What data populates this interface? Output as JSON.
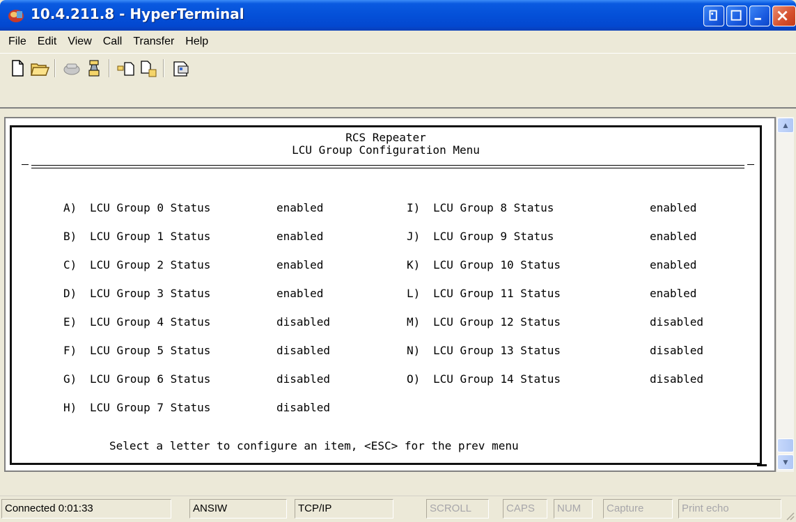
{
  "window": {
    "title": "10.4.211.8 - HyperTerminal"
  },
  "menu": [
    "File",
    "Edit",
    "View",
    "Call",
    "Transfer",
    "Help"
  ],
  "toolbar": {
    "icons": [
      "new-icon",
      "open-icon",
      "disconnect-icon",
      "connect-icon",
      "send-icon",
      "receive-icon",
      "properties-icon"
    ]
  },
  "terminal": {
    "title_line1": "RCS Repeater",
    "title_line2": "LCU Group Configuration Menu",
    "left_items": [
      {
        "key": "A)",
        "label": "LCU Group 0 Status",
        "status": "enabled"
      },
      {
        "key": "B)",
        "label": "LCU Group 1 Status",
        "status": "enabled"
      },
      {
        "key": "C)",
        "label": "LCU Group 2 Status",
        "status": "enabled"
      },
      {
        "key": "D)",
        "label": "LCU Group 3 Status",
        "status": "enabled"
      },
      {
        "key": "E)",
        "label": "LCU Group 4 Status",
        "status": "disabled"
      },
      {
        "key": "F)",
        "label": "LCU Group 5 Status",
        "status": "disabled"
      },
      {
        "key": "G)",
        "label": "LCU Group 6 Status",
        "status": "disabled"
      },
      {
        "key": "H)",
        "label": "LCU Group 7 Status",
        "status": "disabled"
      }
    ],
    "right_items": [
      {
        "key": "I)",
        "label": "LCU Group 8 Status",
        "status": "enabled"
      },
      {
        "key": "J)",
        "label": "LCU Group 9 Status",
        "status": "enabled"
      },
      {
        "key": "K)",
        "label": "LCU Group 10 Status",
        "status": "enabled"
      },
      {
        "key": "L)",
        "label": "LCU Group 11 Status",
        "status": "enabled"
      },
      {
        "key": "M)",
        "label": "LCU Group 12 Status",
        "status": "disabled"
      },
      {
        "key": "N)",
        "label": "LCU Group 13 Status",
        "status": "disabled"
      },
      {
        "key": "O)",
        "label": "LCU Group 14 Status",
        "status": "disabled"
      }
    ],
    "prompt": "Select a letter to configure an item, <ESC> for the prev menu"
  },
  "statusbar": {
    "connected": "Connected 0:01:33",
    "emulation": "ANSIW",
    "transport": "TCP/IP",
    "scroll": "SCROLL",
    "caps": "CAPS",
    "num": "NUM",
    "capture": "Capture",
    "print_echo": "Print echo"
  }
}
